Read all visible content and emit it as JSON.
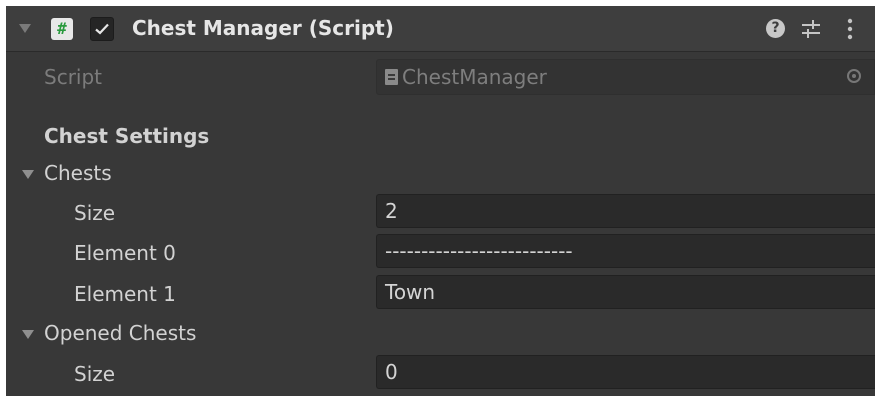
{
  "component": {
    "title": "Chest Manager (Script)",
    "enabled": true,
    "help_glyph": "?"
  },
  "script": {
    "label": "Script",
    "value": "ChestManager"
  },
  "section": {
    "header": "Chest Settings"
  },
  "chests": {
    "label": "Chests",
    "size_label": "Size",
    "size_value": "2",
    "elements": [
      {
        "label": "Element 0",
        "value": "--------------------------"
      },
      {
        "label": "Element 1",
        "value": "Town"
      }
    ]
  },
  "opened_chests": {
    "label": "Opened Chests",
    "size_label": "Size",
    "size_value": "0"
  },
  "icons": {
    "component": "csharp-script-icon",
    "enable": "checkbox-checked-icon",
    "help": "help-icon",
    "presets": "presets-icon",
    "menu": "kebab-menu-icon",
    "foldout": "foldout-arrow-icon",
    "object_picker": "object-picker-icon"
  },
  "colors": {
    "panel_bg": "#383838",
    "header_bg": "#3e3e3e",
    "field_bg": "#2a2a2a",
    "script_icon_accent": "#2a9a3e"
  }
}
